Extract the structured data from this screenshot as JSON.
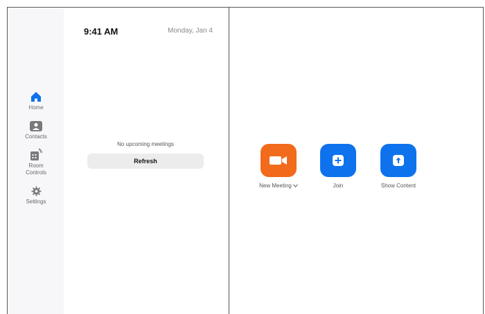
{
  "status": {
    "time": "9:41 AM",
    "date": "Monday, Jan 4"
  },
  "sidebar": {
    "items": [
      {
        "label": "Home",
        "icon": "home-icon",
        "active": true
      },
      {
        "label": "Contacts",
        "icon": "contacts-icon"
      },
      {
        "label": "Room Controls",
        "label_line1": "Room",
        "label_line2": "Controls",
        "icon": "room-controls-icon"
      },
      {
        "label": "Settings",
        "icon": "gear-icon"
      }
    ]
  },
  "meetings": {
    "empty_text": "No upcoming meetings",
    "refresh_label": "Refresh"
  },
  "actions": [
    {
      "label": "New Meeting",
      "icon": "video-camera-icon",
      "color": "#f26a1b"
    },
    {
      "label": "Join",
      "icon": "plus-icon",
      "color": "#0e72ed"
    },
    {
      "label": "Show Content",
      "icon": "share-up-arrow-icon",
      "color": "#0e72ed"
    }
  ],
  "colors": {
    "accent": "#0e72ed",
    "orange": "#f26a1b",
    "sidebar_bg": "#f7f7f9"
  }
}
